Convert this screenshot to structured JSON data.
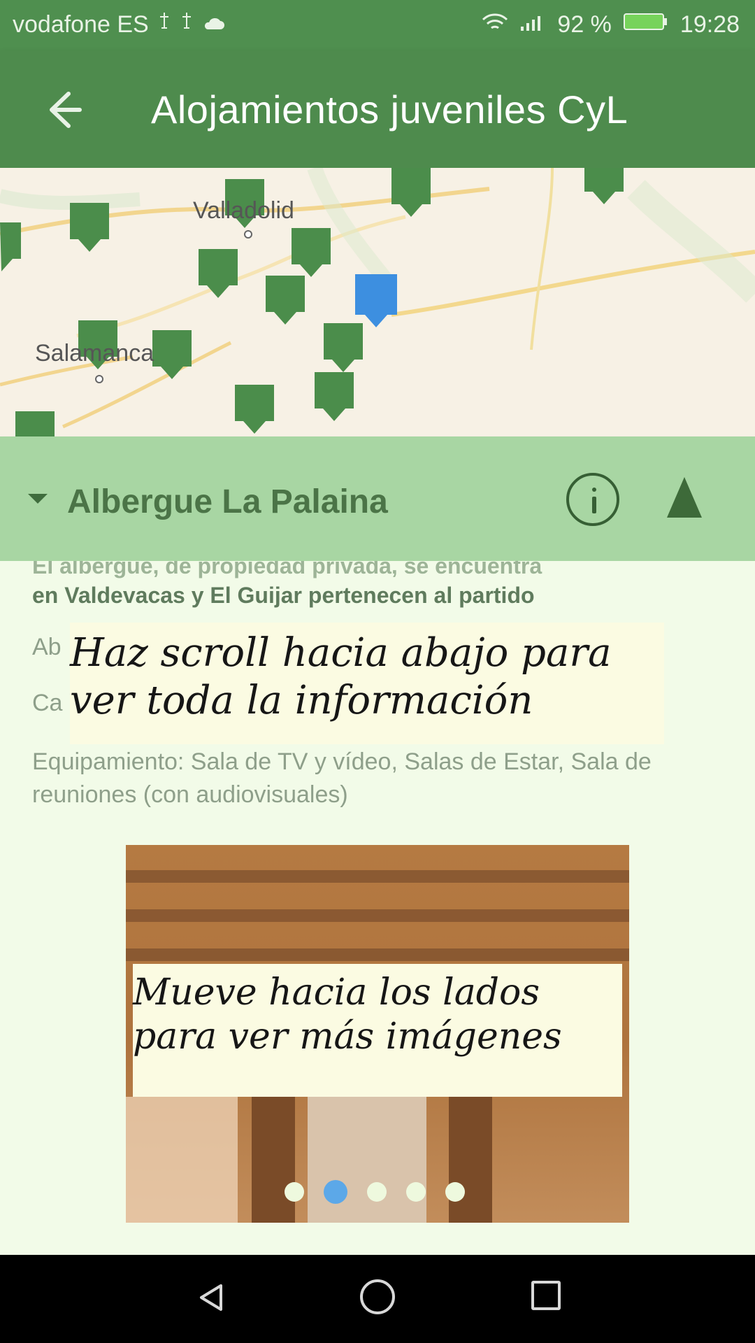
{
  "status_bar": {
    "carrier": "vodafone ES",
    "battery": "92 %",
    "time": "19:28",
    "icons": [
      "usb-icon",
      "usb-icon",
      "cloud-icon",
      "wifi-icon",
      "signal-icon",
      "battery-icon"
    ]
  },
  "toolbar": {
    "title": "Alojamientos juveniles CyL",
    "back_icon": "arrow-back-icon"
  },
  "map": {
    "labels": [
      "Valladolid",
      "Salamanca"
    ]
  },
  "place": {
    "name": "Albergue La Palaina",
    "icons": [
      "chevron-down-icon",
      "info-icon",
      "navigation-icon"
    ]
  },
  "content": {
    "description_partial": "El albergue, de propiedad privada, se encuentra",
    "description_line2": "en Valdevacas y El Guijar pertenecen al partido",
    "row_prefix_1": "Ab",
    "row_prefix_2": "Ca",
    "tip_scroll": "Haz scroll hacia abajo para ver toda la información",
    "equipment": "Equipamiento: Sala de TV y vídeo, Salas de Estar, Sala de reuniones (con audiovisuales)",
    "tip_images": "Mueve hacia los lados para ver más imágenes"
  },
  "gallery": {
    "active_index": 1,
    "dot_count": 5,
    "active_color": "#5ca8e8",
    "inactive_color": "#eef9de"
  },
  "navigation_bar": {
    "icons": [
      "nav-back-icon",
      "nav-home-icon",
      "nav-recent-icon"
    ]
  }
}
